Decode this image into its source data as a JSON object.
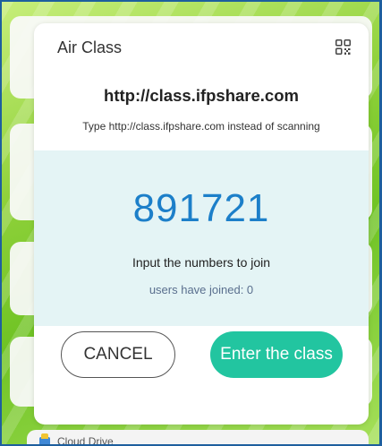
{
  "dialog": {
    "title": "Air Class",
    "url": "http://class.ifpshare.com",
    "hint": "Type http://class.ifpshare.com instead of scanning",
    "code": "891721",
    "join_instruction": "Input the numbers to join",
    "users_joined": "users have joined: 0",
    "cancel_label": "CANCEL",
    "enter_label": "Enter the class"
  },
  "background_app": {
    "cloud_drive_label": "Cloud Drive"
  },
  "icons": {
    "qr": "qr-code-icon",
    "cloud_drive": "cloud-drive-icon"
  },
  "colors": {
    "accent_green": "#22c5a0",
    "code_blue": "#1c7fc9",
    "panel_bg": "#e4f4f5"
  }
}
